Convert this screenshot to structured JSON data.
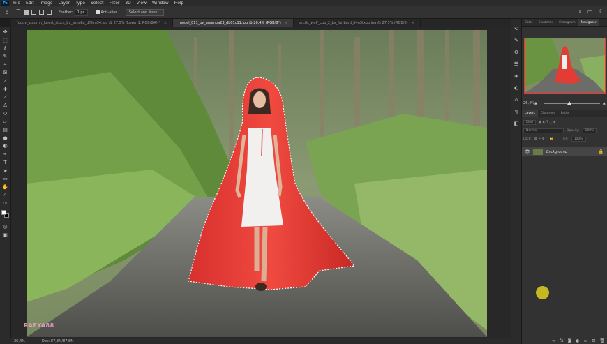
{
  "app": {
    "logo": "Ps",
    "accent": "#31a8ff"
  },
  "menu": [
    "File",
    "Edit",
    "Image",
    "Layer",
    "Type",
    "Select",
    "Filter",
    "3D",
    "View",
    "Window",
    "Help"
  ],
  "options": {
    "feather_label": "Feather:",
    "feather_value": "1 px",
    "antialias_label": "Anti-alias",
    "select_mask_label": "Select and Mask..."
  },
  "tabs": [
    {
      "label": "foggy_autumn_forest_stock_by_ashoka_df9jrg54.jpg @ 27,5% (Layer 1, RGB/8#) *",
      "active": false
    },
    {
      "label": "model_011_by_anamba23_db01c11.jpg @ 26,4% (RGB/8*)",
      "active": true
    },
    {
      "label": "arctic_wolf_cub_2_by_furlbard_d4a3txpo.jpg @ 27,5% (RGB/8)",
      "active": false
    }
  ],
  "tools": [
    "move-icon",
    "marquee-icon",
    "lasso-icon",
    "quick-select-icon",
    "crop-icon",
    "frame-icon",
    "eyedropper-icon",
    "healing-icon",
    "brush-icon",
    "stamp-icon",
    "history-brush-icon",
    "eraser-icon",
    "gradient-icon",
    "blur-icon",
    "dodge-icon",
    "pen-icon",
    "type-icon",
    "path-select-icon",
    "shape-icon",
    "hand-icon",
    "zoom-icon",
    "more-icon"
  ],
  "watermark": "RAFYA88",
  "status": {
    "zoom": "26,4%",
    "doc": "Doc: 87,8M/87,8M"
  },
  "navigator": {
    "tabs": [
      {
        "label": "Color",
        "active": false
      },
      {
        "label": "Swatches",
        "active": false
      },
      {
        "label": "Histogram",
        "active": false
      },
      {
        "label": "Navigator",
        "active": true
      }
    ],
    "zoom": "26,4%",
    "zoom_level": 0.45
  },
  "layers_panel": {
    "tabs": [
      {
        "label": "Layers",
        "active": true
      },
      {
        "label": "Channels",
        "active": false
      },
      {
        "label": "Paths",
        "active": false
      }
    ],
    "filter_kind": "Kind",
    "blend_mode": "Normal",
    "opacity_label": "Opacity:",
    "opacity_value": "100%",
    "lock_label": "Lock:",
    "fill_label": "Fill:",
    "fill_value": "100%",
    "layer_name": "Background"
  }
}
